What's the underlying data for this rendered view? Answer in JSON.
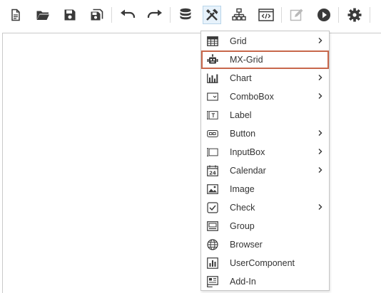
{
  "toolbar": {
    "buttons": [
      {
        "name": "new-document-button",
        "icon": "new-document-icon"
      },
      {
        "name": "open-folder-button",
        "icon": "folder-open-icon"
      },
      {
        "name": "save-button",
        "icon": "save-icon"
      },
      {
        "name": "save-all-button",
        "icon": "save-all-icon"
      },
      {
        "name": "undo-button",
        "icon": "undo-icon"
      },
      {
        "name": "redo-button",
        "icon": "redo-icon"
      },
      {
        "name": "database-button",
        "icon": "database-icon"
      },
      {
        "name": "tools-button",
        "icon": "tools-icon",
        "active": true
      },
      {
        "name": "hierarchy-button",
        "icon": "hierarchy-icon"
      },
      {
        "name": "code-view-button",
        "icon": "code-icon"
      },
      {
        "name": "edit-button",
        "icon": "edit-icon",
        "disabled": true
      },
      {
        "name": "run-button",
        "icon": "play-icon"
      },
      {
        "name": "settings-button",
        "icon": "gear-icon"
      }
    ]
  },
  "menu": {
    "items": [
      {
        "label": "Grid",
        "icon": "grid-icon",
        "submenu": true
      },
      {
        "label": "MX-Grid",
        "icon": "robot-icon",
        "submenu": false,
        "highlighted": true
      },
      {
        "label": "Chart",
        "icon": "chart-icon",
        "submenu": true
      },
      {
        "label": "ComboBox",
        "icon": "combobox-icon",
        "submenu": true
      },
      {
        "label": "Label",
        "icon": "label-icon",
        "submenu": false
      },
      {
        "label": "Button",
        "icon": "button-icon",
        "submenu": true
      },
      {
        "label": "InputBox",
        "icon": "inputbox-icon",
        "submenu": true
      },
      {
        "label": "Calendar",
        "icon": "calendar-icon",
        "submenu": true
      },
      {
        "label": "Image",
        "icon": "image-icon",
        "submenu": false
      },
      {
        "label": "Check",
        "icon": "checkbox-icon",
        "submenu": true
      },
      {
        "label": "Group",
        "icon": "group-icon",
        "submenu": false
      },
      {
        "label": "Browser",
        "icon": "globe-icon",
        "submenu": false
      },
      {
        "label": "UserComponent",
        "icon": "user-component-icon",
        "submenu": false
      },
      {
        "label": "Add-In",
        "icon": "add-in-icon",
        "submenu": false
      }
    ]
  },
  "colors": {
    "icon": "#3a3a3a",
    "highlight_border": "#c8674b",
    "active_bg": "#e7f2fb"
  }
}
